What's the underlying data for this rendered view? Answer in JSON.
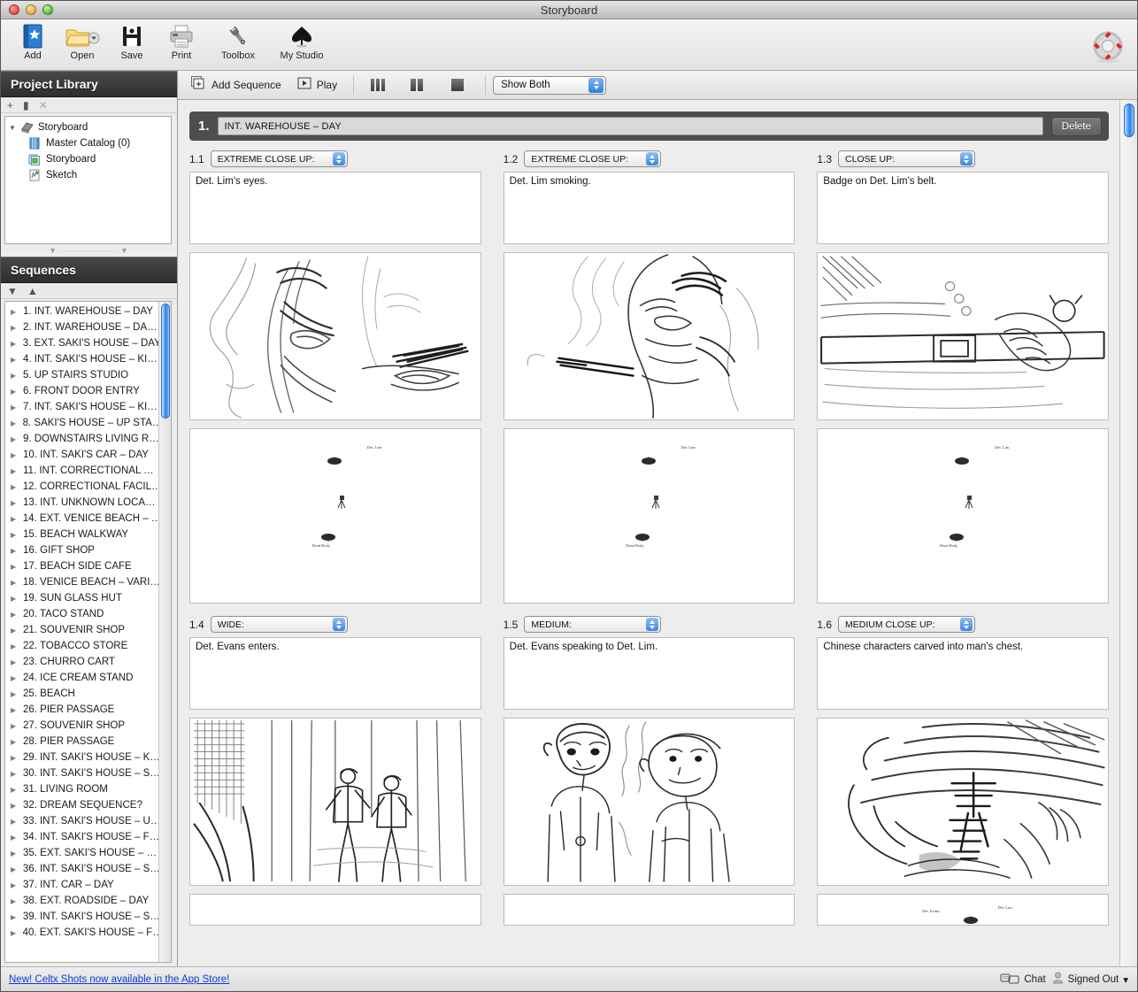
{
  "window": {
    "title": "Storyboard"
  },
  "toolbar": {
    "items": [
      {
        "label": "Add",
        "icon": "add-star-icon"
      },
      {
        "label": "Open",
        "icon": "open-folder-icon"
      },
      {
        "label": "Save",
        "icon": "floppy-disk-icon"
      },
      {
        "label": "Print",
        "icon": "printer-icon"
      },
      {
        "label": "Toolbox",
        "icon": "wrench-icon"
      },
      {
        "label": "My Studio",
        "icon": "spade-tree-icon"
      }
    ],
    "help_icon": "life-preserver-icon"
  },
  "sidebar": {
    "library": {
      "title": "Project Library",
      "actions": [
        {
          "icon": "plus-icon",
          "label": "+"
        },
        {
          "icon": "folder-icon",
          "label": "▮"
        },
        {
          "icon": "close-icon",
          "label": "✕"
        }
      ],
      "tree": [
        {
          "label": "Storyboard",
          "icon": "project-icon",
          "level": 0,
          "expanded": true
        },
        {
          "label": "Master Catalog (0)",
          "icon": "catalog-icon",
          "level": 1
        },
        {
          "label": "Storyboard",
          "icon": "storyboard-icon",
          "level": 1
        },
        {
          "label": "Sketch",
          "icon": "sketch-icon",
          "level": 1
        }
      ]
    },
    "sequences": {
      "title": "Sequences",
      "actions": [
        {
          "icon": "chevron-down-icon",
          "label": "▼"
        },
        {
          "icon": "chevron-up-icon",
          "label": "▲"
        }
      ],
      "items": [
        "1. INT. WAREHOUSE – DAY",
        "2. INT. WAREHOUSE – DA…",
        "3. EXT. SAKI'S HOUSE – DAY",
        "4. INT. SAKI'S HOUSE – KI…",
        "5. UP STAIRS STUDIO",
        "6. FRONT DOOR ENTRY",
        "7. INT. SAKI'S HOUSE – KI…",
        "8. SAKI'S HOUSE – UP STA…",
        "9. DOWNSTAIRS LIVING R…",
        "10. INT. SAKI'S CAR – DAY",
        "11. INT. CORRECTIONAL …",
        "12. CORRECTIONAL FACIL…",
        "13. INT. UNKNOWN LOCA…",
        "14. EXT. VENICE BEACH – …",
        "15. BEACH WALKWAY",
        "16. GIFT SHOP",
        "17. BEACH SIDE CAFE",
        "18. VENICE BEACH – VARI…",
        "19. SUN GLASS HUT",
        "20. TACO STAND",
        "21. SOUVENIR SHOP",
        "22. TOBACCO STORE",
        "23. CHURRO CART",
        "24. ICE CREAM STAND",
        "25. BEACH",
        "26. PIER PASSAGE",
        "27. SOUVENIR SHOP",
        "28. PIER PASSAGE",
        "29. INT. SAKI'S HOUSE – K…",
        "30. INT. SAKI'S HOUSE – S…",
        "31. LIVING ROOM",
        "32. DREAM SEQUENCE?",
        "33. INT. SAKI'S HOUSE – U…",
        "34. INT. SAKI'S HOUSE – F…",
        "35. EXT. SAKI'S HOUSE – …",
        "36. INT. SAKI'S HOUSE – S…",
        "37. INT. CAR – DAY",
        "38. EXT. ROADSIDE – DAY",
        "39. INT. SAKI'S HOUSE – S…",
        "40. EXT. SAKI'S HOUSE – F…"
      ]
    }
  },
  "stage_toolbar": {
    "add_sequence_label": "Add Sequence",
    "play_label": "Play",
    "view_modes": [
      {
        "name": "three-column-view",
        "bars": 3
      },
      {
        "name": "two-column-view",
        "bars": 2
      },
      {
        "name": "one-column-view",
        "bars": 1
      }
    ],
    "show_select": {
      "value": "Show Both"
    }
  },
  "sequence": {
    "number": "1.",
    "title": "INT. WAREHOUSE – DAY",
    "delete_label": "Delete"
  },
  "shots": [
    {
      "number": "1.1",
      "shot_type": "EXTREME CLOSE UP:",
      "description": "Det. Lim's eyes.",
      "sketch": "face-eyes-sketch",
      "plan_labels": [
        "Det. Lim",
        "Dead Body"
      ]
    },
    {
      "number": "1.2",
      "shot_type": "EXTREME CLOSE UP:",
      "description": "Det. Lim smoking.",
      "sketch": "smoking-profile-sketch",
      "plan_labels": [
        "Det. Lim",
        "Dead Body"
      ]
    },
    {
      "number": "1.3",
      "shot_type": "CLOSE UP:",
      "description": "Badge on Det. Lim's belt.",
      "sketch": "badge-belt-sketch",
      "plan_labels": [
        "Det. Lim",
        "Dead Body"
      ]
    },
    {
      "number": "1.4",
      "shot_type": "WIDE:",
      "description": "Det. Evans enters.",
      "sketch": "warehouse-wide-sketch",
      "plan_labels": []
    },
    {
      "number": "1.5",
      "shot_type": "MEDIUM:",
      "description": "Det. Evans speaking to Det. Lim.",
      "sketch": "two-detectives-sketch",
      "plan_labels": []
    },
    {
      "number": "1.6",
      "shot_type": "MEDIUM CLOSE UP:",
      "description": "Chinese characters carved into man's chest.",
      "sketch": "carved-chest-sketch",
      "plan_labels": [
        "Det. Evans",
        "Det. Lim"
      ]
    }
  ],
  "statusbar": {
    "promo": "New! Celtx Shots now available in the App Store!",
    "chat_label": "Chat",
    "chat_icon": "chat-bubbles-icon",
    "account_label": "Signed Out",
    "account_icon": "person-icon",
    "account_caret": "▾"
  }
}
